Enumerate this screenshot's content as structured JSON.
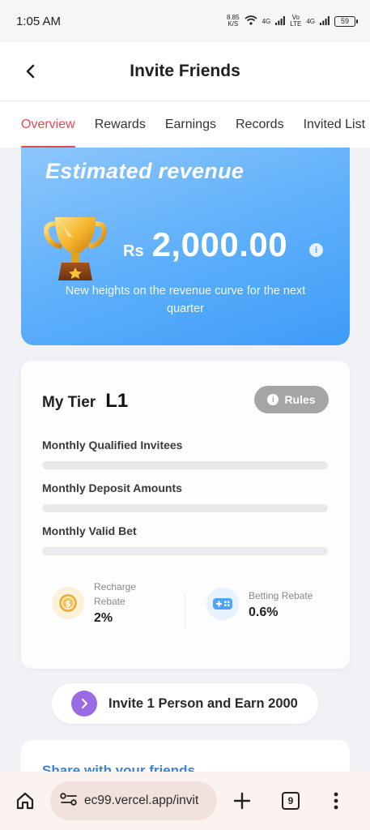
{
  "status_bar": {
    "time": "1:05 AM",
    "net_speed_value": "8.85",
    "net_speed_unit": "K/S",
    "network_1": "4G",
    "network_2_top": "Vo",
    "network_2_bottom": "LTE",
    "network_3": "4G",
    "battery": "59"
  },
  "header": {
    "title": "Invite Friends"
  },
  "tabs": [
    {
      "label": "Overview",
      "active": true
    },
    {
      "label": "Rewards",
      "active": false
    },
    {
      "label": "Earnings",
      "active": false
    },
    {
      "label": "Records",
      "active": false
    },
    {
      "label": "Invited List",
      "active": false
    }
  ],
  "revenue": {
    "title": "Estimated revenue",
    "currency": "Rs",
    "amount": "2,000.00",
    "subtitle": "New heights on the revenue curve for the next quarter"
  },
  "tier": {
    "label": "My Tier",
    "level": "L1",
    "rules_label": "Rules",
    "metrics": [
      {
        "label": "Monthly Qualified Invitees",
        "progress": 0
      },
      {
        "label": "Monthly Deposit Amounts",
        "progress": 0
      },
      {
        "label": "Monthly Valid Bet",
        "progress": 0
      }
    ],
    "recharge_rebate": {
      "label_line1": "Recharge",
      "label_line2": "Rebate",
      "value": "2%"
    },
    "betting_rebate": {
      "label": "Betting Rebate",
      "value": "0.6%"
    }
  },
  "invite": {
    "label": "Invite 1 Person and Earn 2000"
  },
  "share": {
    "title": "Share with your friends"
  },
  "browser": {
    "url": "ec99.vercel.app/invit",
    "tab_count": "9"
  },
  "colors": {
    "accent": "#e8474e",
    "revenue_card": "#5fb0fa",
    "invite_arrow": "#9b6be6",
    "share_title": "#3b82d8"
  }
}
